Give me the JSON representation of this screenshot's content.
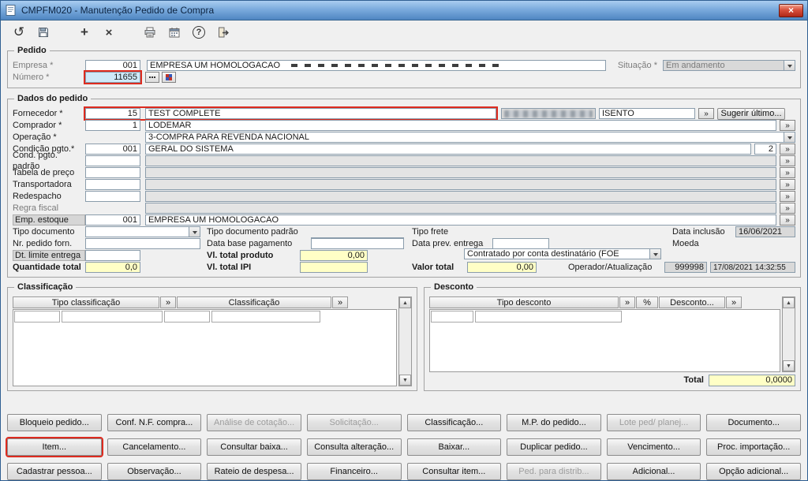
{
  "window": {
    "title": "CMPFM020 - Manutenção Pedido de Compra",
    "close_glyph": "×"
  },
  "toolbar": {
    "undo_glyph": "↺",
    "add_glyph": "+",
    "delete_glyph": "×",
    "help_glyph": "?",
    "icons": [
      "undo-icon",
      "save-icon",
      "add-icon",
      "delete-icon",
      "print-icon",
      "calendar-icon",
      "help-icon",
      "exit-icon"
    ]
  },
  "controls": {
    "zoom_glyph": "»",
    "scroll_up_glyph": "▲",
    "scroll_down_glyph": "▼"
  },
  "pedido": {
    "legend": "Pedido",
    "empresa_label": "Empresa *",
    "empresa_code": "001",
    "empresa_name": "EMPRESA UM HOMOLOGACAO",
    "situacao_label": "Situação *",
    "situacao_value": "Em andamento",
    "numero_label": "Número *",
    "numero_value": "11655"
  },
  "dados": {
    "legend": "Dados do pedido",
    "fornecedor": {
      "label": "Fornecedor *",
      "code": "15",
      "name": "TEST COMPLETE",
      "tax_status": "ISENTO",
      "suggest_button": "Sugerir último..."
    },
    "comprador": {
      "label": "Comprador *",
      "code": "1",
      "name": "LODEMAR"
    },
    "operacao": {
      "label": "Operação *",
      "value": "3-COMPRA PARA REVENDA NACIONAL"
    },
    "condicao_pgto": {
      "label": "Condição pgto.*",
      "code": "001",
      "name": "GERAL DO SISTEMA",
      "parcelas": "2"
    },
    "cond_pgto_padrao_label": "Cond. pgto. padrão",
    "tabela_preco_label": "Tabela de preço",
    "transportadora_label": "Transportadora",
    "redespacho_label": "Redespacho",
    "regra_fiscal_label": "Regra fiscal",
    "emp_estoque": {
      "label": "Emp. estoque",
      "code": "001",
      "name": "EMPRESA UM HOMOLOGACAO"
    },
    "tipo_documento_label": "Tipo documento",
    "tipo_documento_padrao_label": "Tipo documento padrão",
    "tipo_frete": {
      "label": "Tipo frete",
      "value": "Contratado por conta destinatário (FOE"
    },
    "data_inclusao": {
      "label": "Data inclusão",
      "value": "16/06/2021"
    },
    "nr_pedido_forn_label": "Nr. pedido forn.",
    "data_base_pagamento_label": "Data base pagamento",
    "data_prev_entrega_label": "Data prev. entrega",
    "moeda_label": "Moeda",
    "dt_limite_entrega_label": "Dt. limite entrega",
    "vl_total_produto": {
      "label": "Vl. total produto",
      "value": "0,00"
    },
    "quantidade_total": {
      "label": "Quantidade total",
      "value": "0,0"
    },
    "vl_total_ipi": {
      "label": "Vl. total IPI",
      "value": ""
    },
    "valor_total": {
      "label": "Valor total",
      "value": "0,00"
    },
    "operador": {
      "label": "Operador/Atualização",
      "code": "999998",
      "updated_at": "17/08/2021 14:32:55"
    }
  },
  "classificacao": {
    "legend": "Classificação",
    "headers": [
      "Tipo classificação",
      "»",
      "Classificação",
      "»"
    ]
  },
  "desconto": {
    "legend": "Desconto",
    "headers": [
      "Tipo desconto",
      "»",
      "%",
      "Desconto...",
      "»"
    ],
    "total_label": "Total",
    "total_value": "0,0000"
  },
  "footer": {
    "rows": [
      [
        {
          "label": "Bloqueio pedido...",
          "enabled": true
        },
        {
          "label": "Conf. N.F. compra...",
          "enabled": true
        },
        {
          "label": "Análise de cotação...",
          "enabled": false
        },
        {
          "label": "Solicitação...",
          "enabled": false
        },
        {
          "label": "Classificação...",
          "enabled": true
        },
        {
          "label": "M.P. do pedido...",
          "enabled": true
        },
        {
          "label": "Lote ped/ planej...",
          "enabled": false
        },
        {
          "label": "Documento...",
          "enabled": true
        }
      ],
      [
        {
          "label": "Item...",
          "enabled": true,
          "highlighted": true
        },
        {
          "label": "Cancelamento...",
          "enabled": true
        },
        {
          "label": "Consultar baixa...",
          "enabled": true
        },
        {
          "label": "Consulta alteração...",
          "enabled": true
        },
        {
          "label": "Baixar...",
          "enabled": true
        },
        {
          "label": "Duplicar pedido...",
          "enabled": true
        },
        {
          "label": "Vencimento...",
          "enabled": true
        },
        {
          "label": "Proc. importação...",
          "enabled": true
        }
      ],
      [
        {
          "label": "Cadastrar pessoa...",
          "enabled": true
        },
        {
          "label": "Observação...",
          "enabled": true
        },
        {
          "label": "Rateio de despesa...",
          "enabled": true
        },
        {
          "label": "Financeiro...",
          "enabled": true
        },
        {
          "label": "Consultar item...",
          "enabled": true
        },
        {
          "label": "Ped. para distrib...",
          "enabled": false
        },
        {
          "label": "Adicional...",
          "enabled": true
        },
        {
          "label": "Opção adicional...",
          "enabled": true
        }
      ]
    ]
  }
}
